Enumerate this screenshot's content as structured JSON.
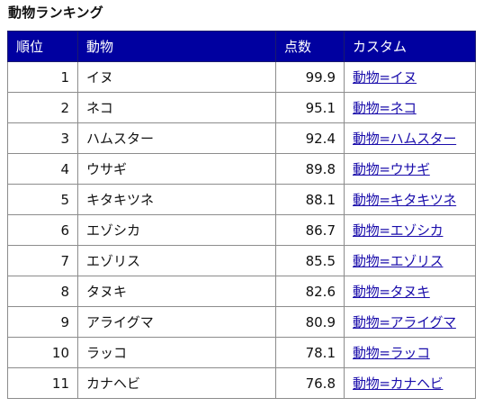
{
  "title": "動物ランキング",
  "table": {
    "headers": {
      "rank": "順位",
      "animal": "動物",
      "score": "点数",
      "custom": "カスタム"
    },
    "rows": [
      {
        "rank": "1",
        "animal": "イヌ",
        "score": "99.9",
        "custom": "動物=イヌ"
      },
      {
        "rank": "2",
        "animal": "ネコ",
        "score": "95.1",
        "custom": "動物=ネコ"
      },
      {
        "rank": "3",
        "animal": "ハムスター",
        "score": "92.4",
        "custom": "動物=ハムスター"
      },
      {
        "rank": "4",
        "animal": "ウサギ",
        "score": "89.8",
        "custom": "動物=ウサギ"
      },
      {
        "rank": "5",
        "animal": "キタキツネ",
        "score": "88.1",
        "custom": "動物=キタキツネ"
      },
      {
        "rank": "6",
        "animal": "エゾシカ",
        "score": "86.7",
        "custom": "動物=エゾシカ"
      },
      {
        "rank": "7",
        "animal": "エゾリス",
        "score": "85.5",
        "custom": "動物=エゾリス"
      },
      {
        "rank": "8",
        "animal": "タヌキ",
        "score": "82.6",
        "custom": "動物=タヌキ"
      },
      {
        "rank": "9",
        "animal": "アライグマ",
        "score": "80.9",
        "custom": "動物=アライグマ"
      },
      {
        "rank": "10",
        "animal": "ラッコ",
        "score": "78.1",
        "custom": "動物=ラッコ"
      },
      {
        "rank": "11",
        "animal": "カナヘビ",
        "score": "76.8",
        "custom": "動物=カナヘビ"
      }
    ]
  },
  "colors": {
    "header_bg": "#0000a0",
    "header_text": "#ffffff",
    "link": "#1a0dab",
    "border": "#8c8c8c"
  }
}
